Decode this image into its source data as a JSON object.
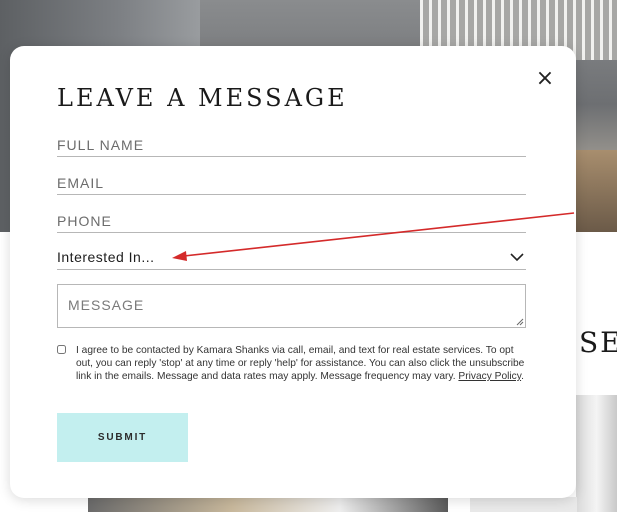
{
  "modal": {
    "title": "LEAVE A MESSAGE",
    "close_label": "×"
  },
  "form": {
    "full_name_placeholder": "FULL NAME",
    "email_placeholder": "EMAIL",
    "phone_placeholder": "PHONE",
    "interested_value": "Interested In...",
    "message_placeholder": "MESSAGE",
    "consent_text": "I agree to be contacted by Kamara Shanks via call, email, and text for real estate services. To opt out, you can reply 'stop' at any time or reply 'help' for assistance. You can also click the unsubscribe link in the emails. Message and data rates may apply. Message frequency may vary.",
    "privacy_link": "Privacy Policy",
    "consent_end": ".",
    "submit_label": "SUBMIT"
  },
  "background": {
    "heading_fragment": "SE"
  },
  "colors": {
    "submit_bg": "#c3efef",
    "arrow": "#d42a2a"
  },
  "icons": {
    "close": "close-icon",
    "dropdown": "chevron-down-icon"
  }
}
